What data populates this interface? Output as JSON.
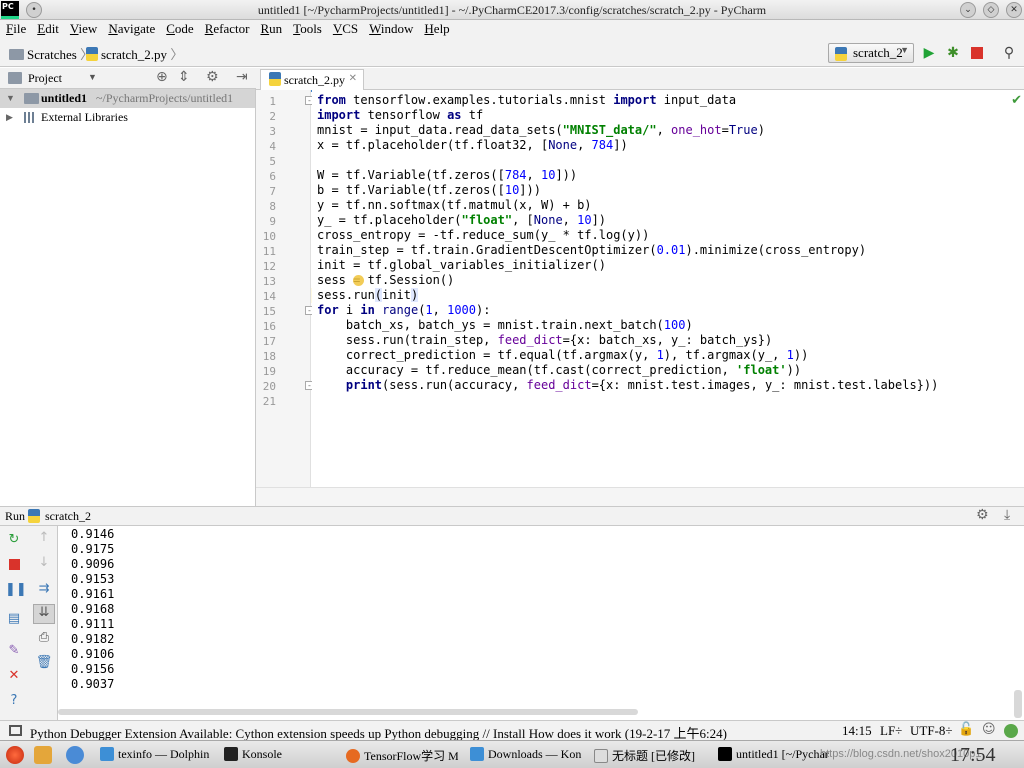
{
  "window": {
    "title": "untitled1 [~/PycharmProjects/untitled1] - ~/.PyCharmCE2017.3/config/scratches/scratch_2.py - PyCharm",
    "app_icon_text": "PC"
  },
  "menu": [
    "File",
    "Edit",
    "View",
    "Navigate",
    "Code",
    "Refactor",
    "Run",
    "Tools",
    "VCS",
    "Window",
    "Help"
  ],
  "breadcrumb": {
    "root": "Scratches",
    "file": "scratch_2.py"
  },
  "run_config": "scratch_2",
  "project_panel": {
    "title": "Project",
    "root_name": "untitled1",
    "root_path": "~/PycharmProjects/untitled1",
    "libs": "External Libraries"
  },
  "editor": {
    "tab": "scratch_2.py",
    "line_numbers": [
      "1",
      "2",
      "3",
      "4",
      "5",
      "6",
      "7",
      "8",
      "9",
      "10",
      "11",
      "12",
      "13",
      "14",
      "15",
      "16",
      "17",
      "18",
      "19",
      "20",
      "21"
    ]
  },
  "run_panel": {
    "label": "Run",
    "config": "scratch_2",
    "output": [
      "0.9146",
      "0.9175",
      "0.9096",
      "0.9153",
      "0.9161",
      "0.9168",
      "0.9111",
      "0.9182",
      "0.9106",
      "0.9156",
      "0.9037"
    ]
  },
  "status": {
    "message": "Python Debugger Extension Available: Cython extension speeds up Python debugging // Install How does it work (19-2-17 上午6:24)",
    "position": "14:15",
    "line_sep": "LF÷",
    "encoding": "UTF-8÷"
  },
  "taskbar": {
    "items": [
      "texinfo — Dolphin",
      "Konsole",
      "TensorFlow学习 M",
      "Downloads — Kon",
      "无标题 [已修改]",
      "untitled1 [~/Pychar"
    ],
    "clock": "17:54"
  },
  "watermark": "https://blog.csdn.net/shox2010p1"
}
